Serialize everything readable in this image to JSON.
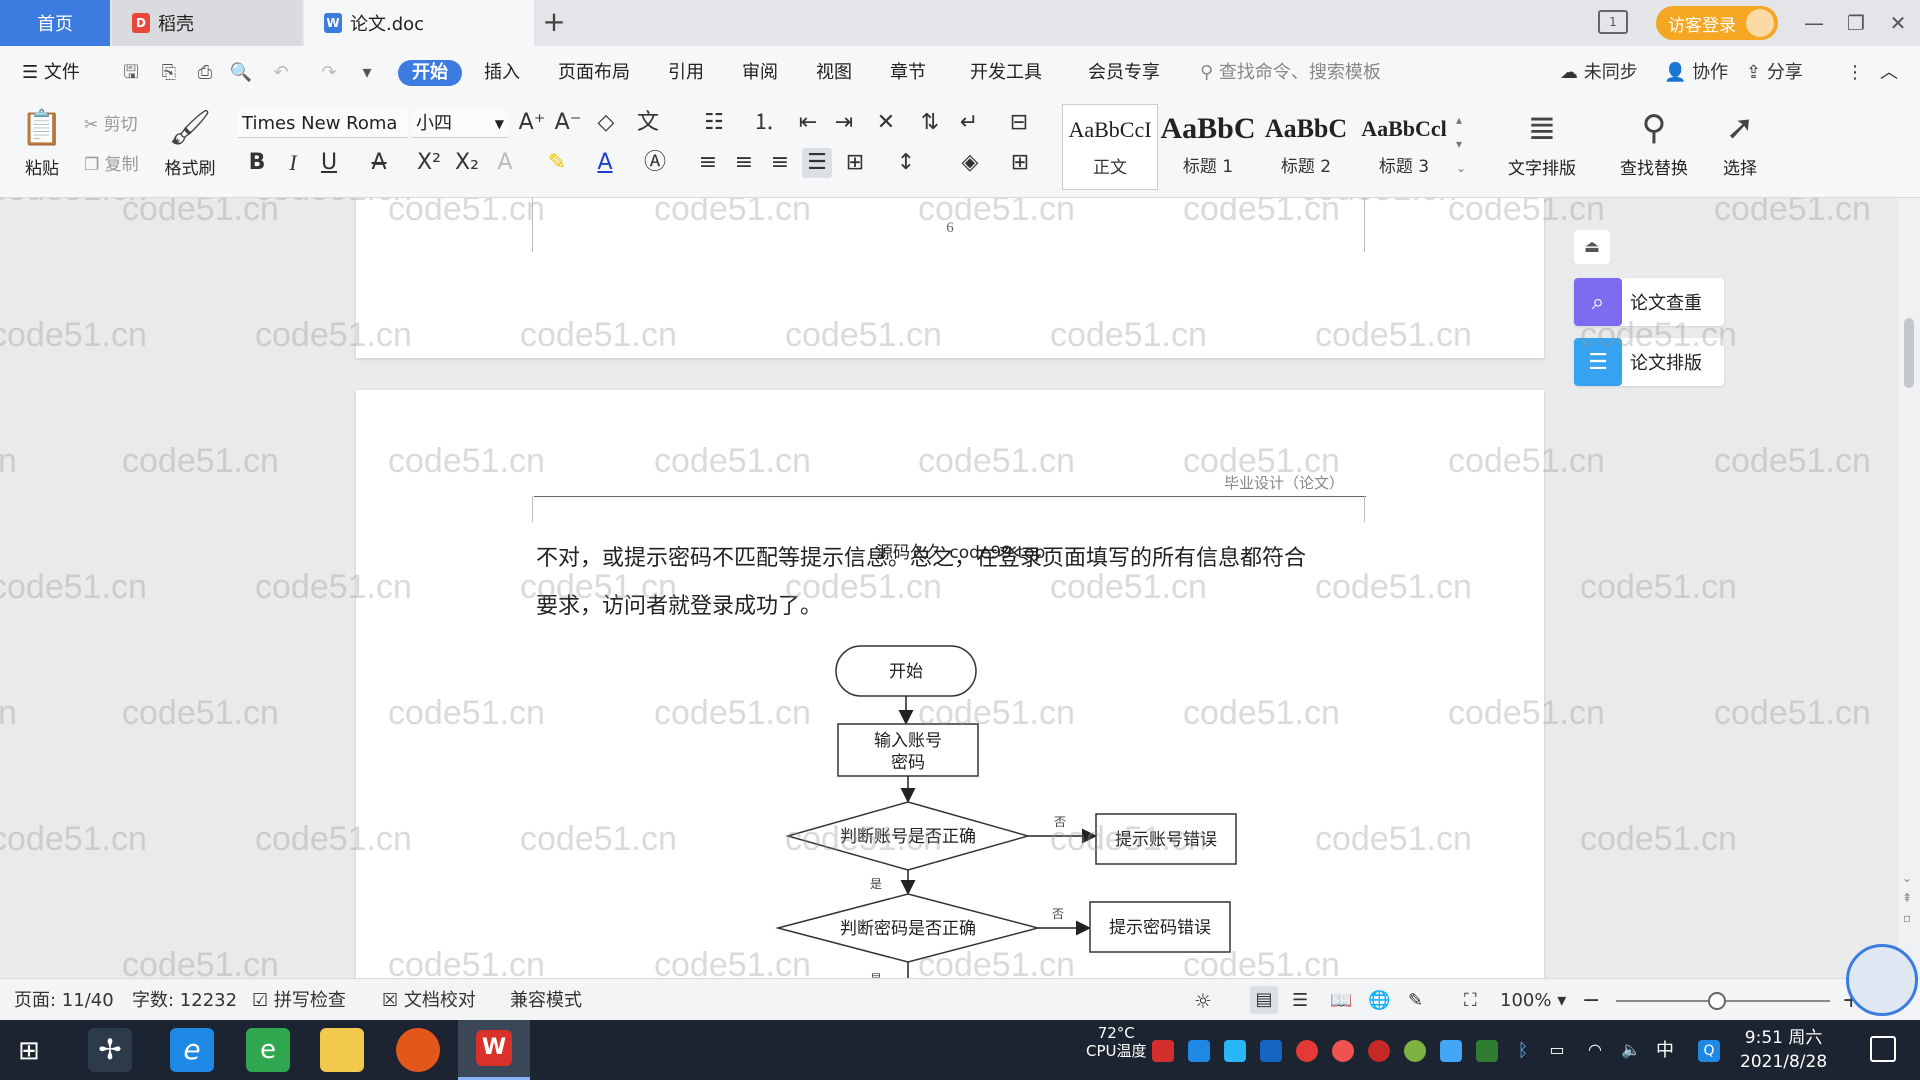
{
  "titlebar": {
    "tabs": [
      {
        "label": "首页"
      },
      {
        "label": "稻壳"
      },
      {
        "label": "论文.doc"
      }
    ],
    "new_tab": "+",
    "login": "访客登录"
  },
  "menu": {
    "file": "文件",
    "items": [
      "开始",
      "插入",
      "页面布局",
      "引用",
      "审阅",
      "视图",
      "章节",
      "开发工具",
      "会员专享"
    ],
    "search_placeholder": "查找命令、搜索模板",
    "sync": "未同步",
    "collab": "协作",
    "share": "分享"
  },
  "ribbon": {
    "paste": "粘贴",
    "cut": "剪切",
    "copy": "复制",
    "format_painter": "格式刷",
    "font_name": "Times New Roma",
    "font_size": "小四",
    "styles": [
      {
        "sample": "AaBbCcI",
        "name": "正文"
      },
      {
        "sample": "AaBbC",
        "name": "标题 1"
      },
      {
        "sample": "AaBbC",
        "name": "标题 2"
      },
      {
        "sample": "AaBbCcl",
        "name": "标题 3"
      }
    ],
    "text_layout": "文字排版",
    "find_replace": "查找替换",
    "select": "选择"
  },
  "document": {
    "prev_page_number": "6",
    "header_text": "毕业设计（论文）",
    "line1": "不对，或提示密码不匹配等提示信息。总之，在登录页面填写的所有信息都符合",
    "line2": "要求，访问者就登录成功了。",
    "overlay_text": "源码久久 code99.top",
    "watermark": "code51.cn",
    "flowchart": {
      "start": "开始",
      "input": "输入账号密码",
      "check_account": "判断账号是否正确",
      "account_error": "提示账号错误",
      "check_password": "判断密码是否正确",
      "password_error": "提示密码错误",
      "no": "否",
      "yes": "是"
    }
  },
  "side_panel": {
    "check": "论文查重",
    "layout": "论文排版"
  },
  "status": {
    "page": "页面: 11/40",
    "words": "字数: 12232",
    "spell": "拼写检查",
    "proof": "文档校对",
    "compat": "兼容模式",
    "zoom": "100%"
  },
  "taskbar": {
    "temperature": "72°C",
    "temp_label": "CPU温度",
    "time": "9:51 周六",
    "date": "2021/8/28",
    "ime": "中"
  },
  "colors": {
    "accent": "#3c7be0",
    "login": "#f5a623",
    "check_icon": "#7b6cf0",
    "layout_icon": "#35a3f0",
    "taskbar": "#1b2430"
  }
}
